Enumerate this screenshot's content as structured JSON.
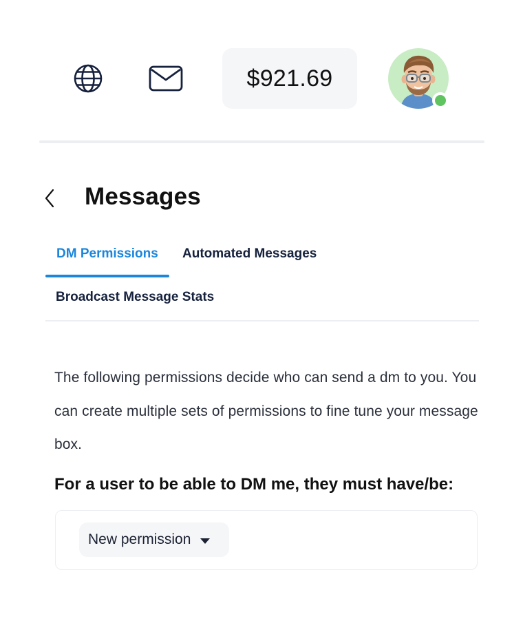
{
  "header": {
    "globe_icon": "globe-icon",
    "mail_icon": "envelope-icon",
    "balance": "$921.69",
    "avatar_icon": "avatar-memoji",
    "status_color": "#5fc35f"
  },
  "page": {
    "back_icon": "chevron-left-icon",
    "title": "Messages"
  },
  "tabs": [
    {
      "label": "DM Permissions",
      "active": true
    },
    {
      "label": "Automated Messages",
      "active": false
    },
    {
      "label": "Broadcast Message Stats",
      "active": false
    }
  ],
  "content": {
    "description": "The following permissions decide who can send a dm to you. You can create multiple sets of permissions to fine tune your message box.",
    "requirement_heading": "For a user to be able to DM me, they must have/be:",
    "permission_select": {
      "selected": "New permission",
      "icon": "caret-down-icon"
    }
  },
  "colors": {
    "accent": "#1b86dc",
    "tab_text": "#16213d",
    "divider": "#eceef1"
  }
}
